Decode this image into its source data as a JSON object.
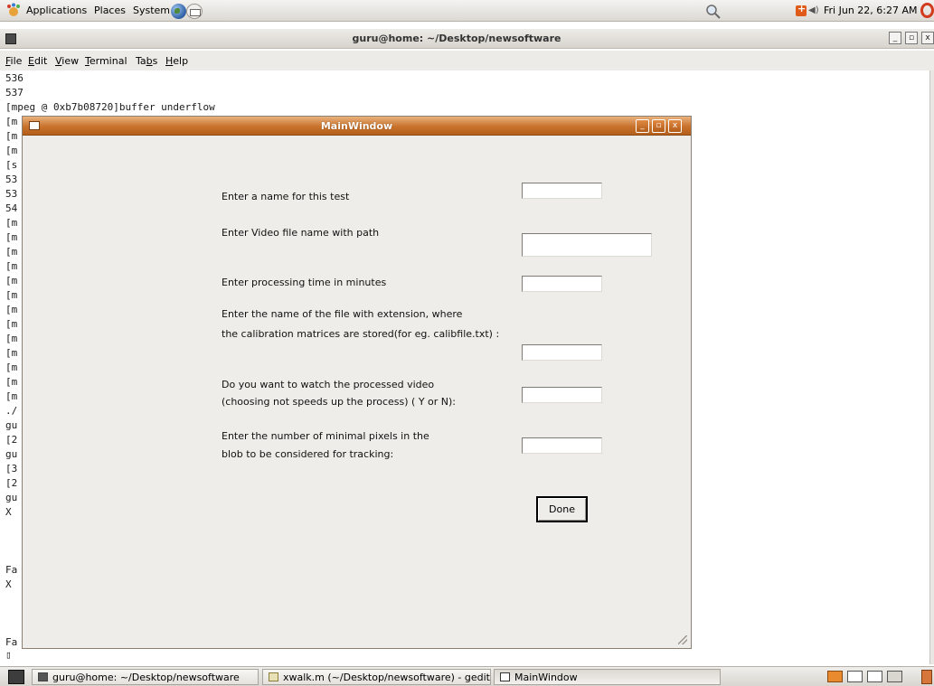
{
  "top_panel": {
    "menus": [
      "Applications",
      "Places",
      "System"
    ],
    "clock": "Fri Jun 22,  6:27 AM",
    "icons": [
      "foot-icon",
      "globe-icon",
      "mail-icon",
      "search-icon",
      "notification-icon",
      "volume-icon",
      "power-icon"
    ]
  },
  "terminal": {
    "title": "guru@home: ~/Desktop/newsoftware",
    "menu": [
      "File",
      "Edit",
      "View",
      "Terminal",
      "Tabs",
      "Help"
    ],
    "lines": [
      "536",
      "537",
      "[mpeg @ 0xb7b08720]buffer underflow",
      "[m",
      "[m",
      "[m",
      "[s",
      "53",
      "53",
      "54",
      "[m",
      "[m",
      "[m",
      "[m",
      "[m",
      "[m",
      "[m",
      "[m",
      "[m",
      "[m",
      "[m",
      "[m",
      "[m",
      "./",
      "gu",
      "[2",
      "gu",
      "[3",
      "[2",
      "gu",
      "X",
      "Fa",
      "X",
      "Fa",
      "▯"
    ]
  },
  "mainwindow": {
    "title": "MainWindow",
    "fields": [
      {
        "label": "Enter a name for this test",
        "value": ""
      },
      {
        "label": "Enter Video file name with path",
        "value": ""
      },
      {
        "label": "Enter processing time in minutes",
        "value": ""
      },
      {
        "label_line1": "Enter the name of the file with extension, where",
        "label_line2": "the calibration matrices are stored(for eg. calibfile.txt) :",
        "value": ""
      },
      {
        "label_line1": "Do you want to watch the processed video",
        "label_line2": "(choosing not speeds up the process) ( Y or N):",
        "value": ""
      },
      {
        "label_line1": "Enter the number of minimal pixels in the",
        "label_line2": "blob to be considered for tracking:",
        "value": ""
      }
    ],
    "done_label": "Done"
  },
  "taskbar": {
    "tasks": [
      {
        "label": "guru@home: ~/Desktop/newsoftware",
        "active": false
      },
      {
        "label": "xwalk.m (~/Desktop/newsoftware) - gedit",
        "active": false
      },
      {
        "label": "MainWindow",
        "active": true
      }
    ]
  },
  "colors": {
    "title_orange": "#c8722c",
    "panel_bg": "#dcd9d4",
    "window_bg": "#efedea"
  }
}
